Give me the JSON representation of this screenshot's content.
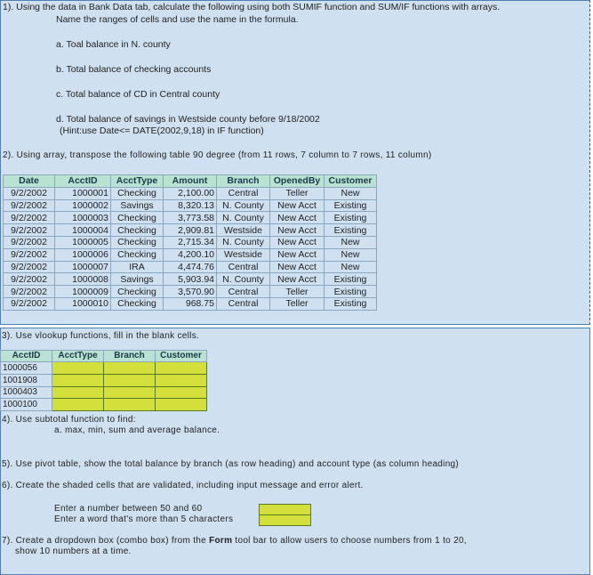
{
  "q1": {
    "line1": "1).  Using the data in Bank Data tab, calculate the following using both SUMIF function and SUM/IF functions with arrays.",
    "line2": "Name the ranges of cells and use the name in the formula.",
    "a": "a. Toal balance in N. county",
    "b": "b. Total balance of checking accounts",
    "c": "c. Total balance of CD in Central county",
    "d": "d. Total balance of savings in Westside county before 9/18/2002",
    "d_hint": "(Hint:use Date<= DATE(2002,9,18) in IF function)"
  },
  "q2": {
    "text": "2). Using array, transpose the following table 90 degree (from 11 rows, 7 column to 7 rows, 11 column)",
    "headers": [
      "Date",
      "AcctID",
      "AcctType",
      "Amount",
      "Branch",
      "OpenedBy",
      "Customer"
    ],
    "rows": [
      [
        "9/2/2002",
        "1000001",
        "Checking",
        "2,100.00",
        "Central",
        "Teller",
        "New"
      ],
      [
        "9/2/2002",
        "1000002",
        "Savings",
        "8,320.13",
        "N. County",
        "New Acct",
        "Existing"
      ],
      [
        "9/2/2002",
        "1000003",
        "Checking",
        "3,773.58",
        "N. County",
        "New Acct",
        "Existing"
      ],
      [
        "9/2/2002",
        "1000004",
        "Checking",
        "2,909.81",
        "Westside",
        "New Acct",
        "Existing"
      ],
      [
        "9/2/2002",
        "1000005",
        "Checking",
        "2,715.34",
        "N. County",
        "New Acct",
        "New"
      ],
      [
        "9/2/2002",
        "1000006",
        "Checking",
        "4,200.10",
        "Westside",
        "New Acct",
        "New"
      ],
      [
        "9/2/2002",
        "1000007",
        "IRA",
        "4,474.76",
        "Central",
        "New Acct",
        "New"
      ],
      [
        "9/2/2002",
        "1000008",
        "Savings",
        "5,903.94",
        "N. County",
        "New Acct",
        "Existing"
      ],
      [
        "9/2/2002",
        "1000009",
        "Checking",
        "3,570.90",
        "Central",
        "Teller",
        "Existing"
      ],
      [
        "9/2/2002",
        "1000010",
        "Checking",
        "968.75",
        "Central",
        "Teller",
        "Existing"
      ]
    ]
  },
  "q3": {
    "text": "3). Use vlookup functions,  fill in the blank cells.",
    "headers": [
      "AcctID",
      "AcctType",
      "Branch",
      "Customer"
    ],
    "ids": [
      "1000056",
      "1001908",
      "1000403",
      "1000100"
    ]
  },
  "q4": {
    "text": "4). Use subtotal function to find:",
    "a": "a. max, min, sum and average balance."
  },
  "q5": {
    "text": "5). Use pivot table, show the total balance by branch (as row heading) and account type (as column heading)"
  },
  "q6": {
    "text": "6). Create the shaded cells that are validated, including input message and error alert.",
    "v1": "Enter a number between 50 and 60",
    "v2": "Enter a word that's more than 5 characters"
  },
  "q7": {
    "pre": "7). Create a dropdown box (combo box) from the ",
    "bold": "Form",
    "post": " tool bar to allow users to choose numbers from 1 to 20,",
    "line2": "show 10 numbers at a time."
  },
  "colors": {
    "panel": "#cfe0f1",
    "header": "#b9e2d2",
    "shaded": "#d3e03c"
  }
}
